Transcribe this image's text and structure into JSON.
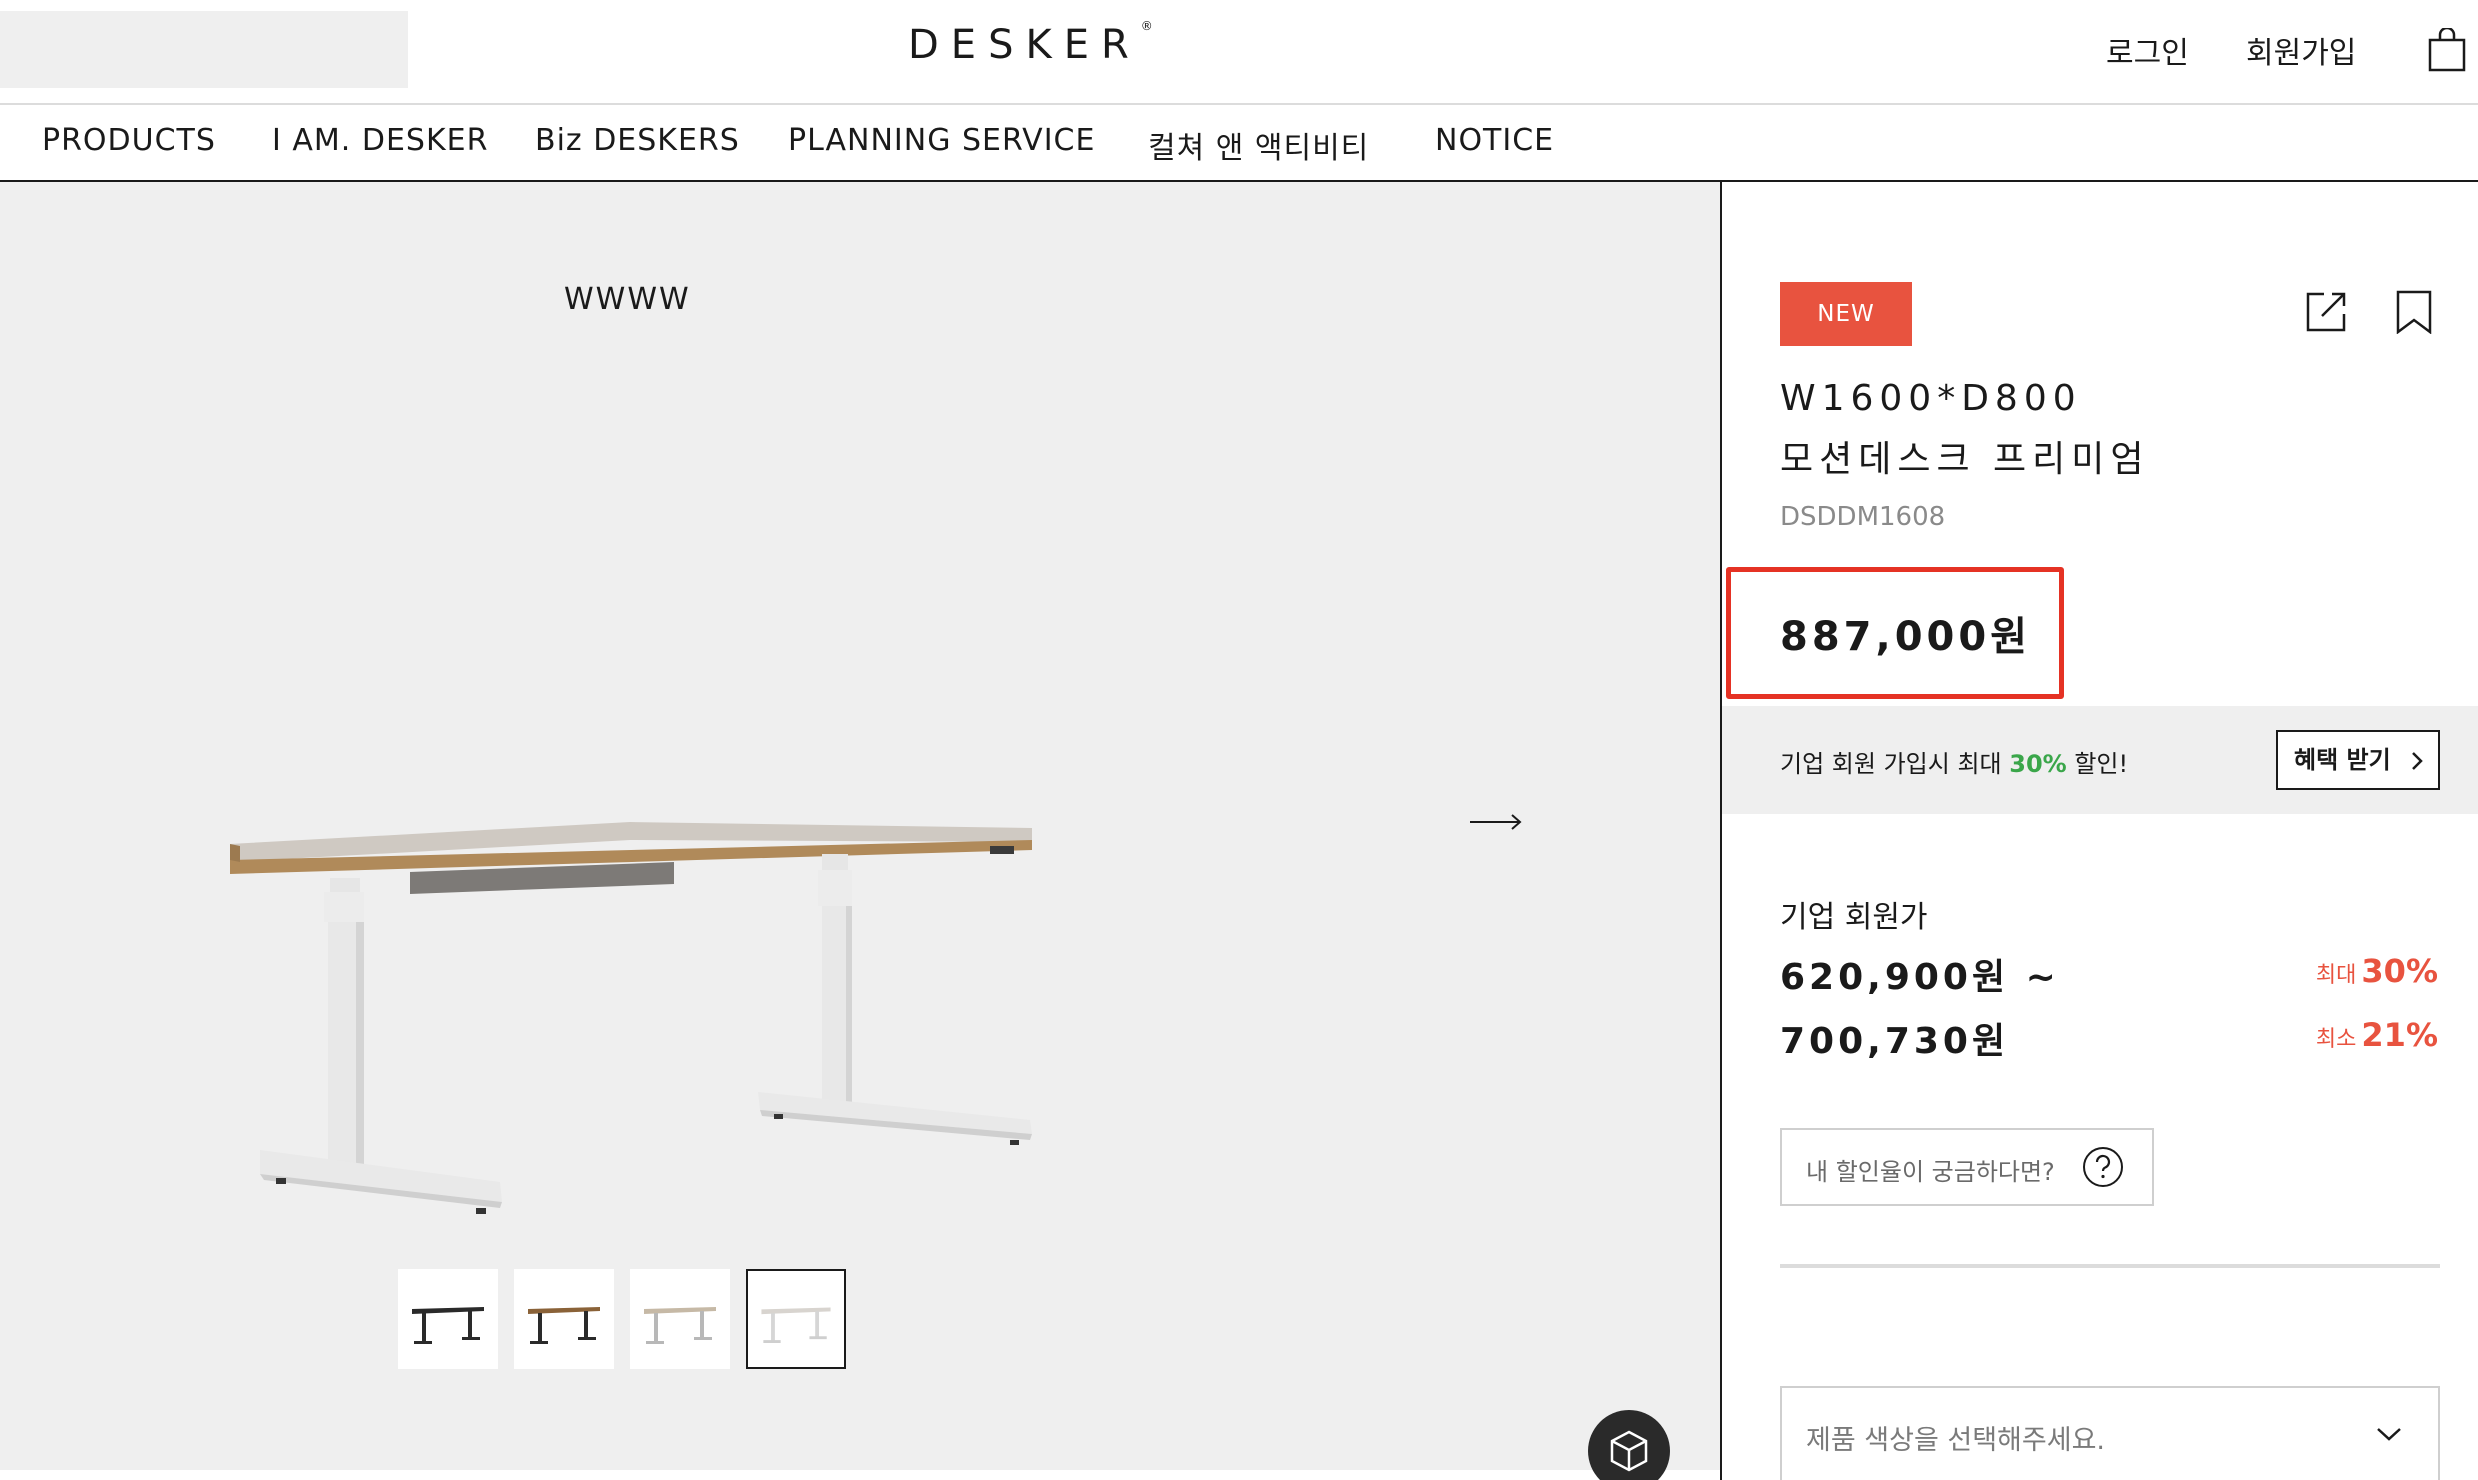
{
  "header": {
    "brand": "DESKER",
    "brand_mark": "®",
    "login": "로그인",
    "signup": "회원가입",
    "cart_icon": "shopping-bag-icon"
  },
  "nav": {
    "items": [
      "PRODUCTS",
      "I AM. DESKER",
      "Biz DESKERS",
      "PLANNING SERVICE",
      "컬쳐 앤 액티비티",
      "NOTICE"
    ]
  },
  "gallery": {
    "label": "WWWW",
    "next_icon": "arrow-right-icon",
    "viewer_icon": "cube-3d-icon",
    "thumbnails": [
      {
        "finish": "black",
        "active": false
      },
      {
        "finish": "walnut",
        "active": false
      },
      {
        "finish": "beige",
        "active": false
      },
      {
        "finish": "white",
        "active": true
      }
    ]
  },
  "product": {
    "badge": "NEW",
    "title_line1": "W1600*D800",
    "title_line2": "모션데스크 프리미엄",
    "sku": "DSDDM1608",
    "price": "887,000원",
    "share_icon": "share-icon",
    "bookmark_icon": "bookmark-icon"
  },
  "promo": {
    "text_before": "기업 회원 가입시 최대 ",
    "percent": "30%",
    "text_after": " 할인!",
    "button": "혜택 받기"
  },
  "member_pricing": {
    "label": "기업 회원가",
    "price_from": "620,900원 ~",
    "price_to": "700,730원",
    "max_label": "최대",
    "max_rate": "30%",
    "min_label": "최소",
    "min_rate": "21%"
  },
  "discount_query": {
    "text": "내 할인율이 궁금하다면?",
    "icon": "question-circle-icon"
  },
  "color_select": {
    "placeholder": "제품 색상을 선택해주세요.",
    "icon": "chevron-down-icon"
  },
  "colors": {
    "accent": "#e8533f",
    "highlight_box": "#e53224",
    "promo_green": "#3aa64a",
    "panel_bg": "#efefef"
  }
}
